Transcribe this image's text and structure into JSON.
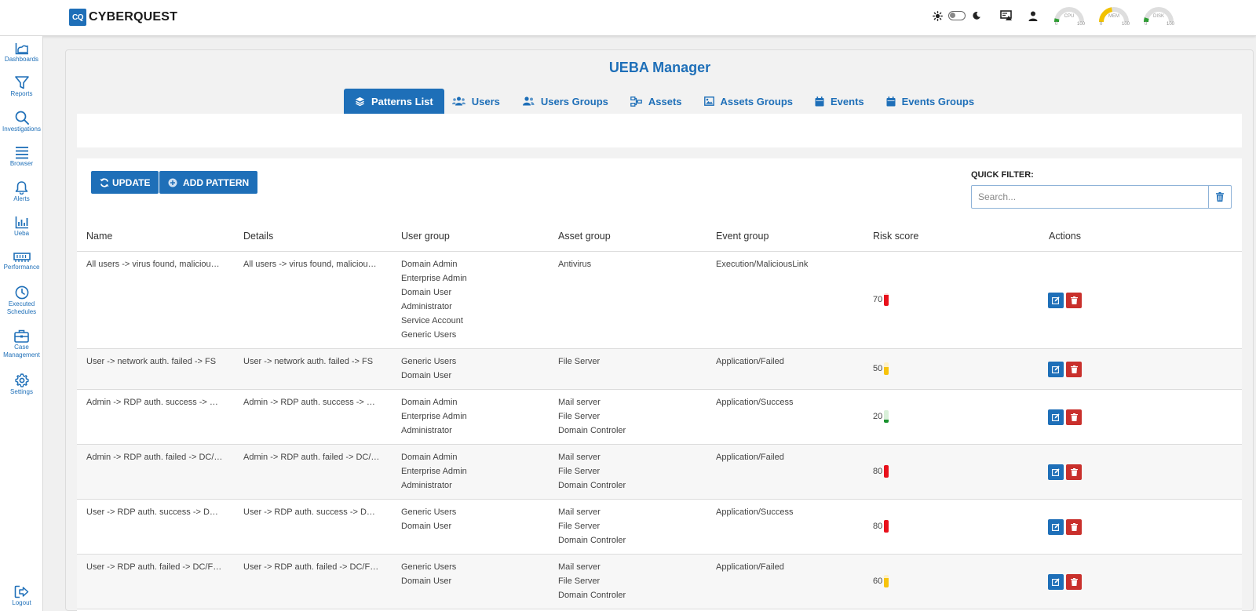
{
  "brand": {
    "mark": "CQ",
    "name": "CYBERQUEST"
  },
  "gauges": [
    {
      "label": "CPU",
      "min": "0",
      "max": "100",
      "value": 8,
      "color": "#2e9e33"
    },
    {
      "label": "MEM",
      "min": "0",
      "max": "100",
      "value": 45,
      "color": "#f2c200"
    },
    {
      "label": "DISK",
      "min": "0",
      "max": "100",
      "value": 10,
      "color": "#2e9e33"
    }
  ],
  "sidebar": {
    "items": [
      {
        "label": "Dashboards",
        "icon": "chart-area-icon"
      },
      {
        "label": "Reports",
        "icon": "filter-icon"
      },
      {
        "label": "Investigations",
        "icon": "search-icon"
      },
      {
        "label": "Browser",
        "icon": "list-icon"
      },
      {
        "label": "Alerts",
        "icon": "bell-icon"
      },
      {
        "label": "Ueba",
        "icon": "bar-chart-icon"
      },
      {
        "label": "Performance",
        "icon": "memory-icon"
      },
      {
        "label1": "Executed",
        "label2": "Schedules",
        "icon": "clock-icon"
      },
      {
        "label1": "Case",
        "label2": "Management",
        "icon": "briefcase-icon"
      },
      {
        "label": "Settings",
        "icon": "gear-icon"
      }
    ],
    "logout": "Logout"
  },
  "page": {
    "title": "UEBA Manager"
  },
  "tabs": [
    {
      "label": "Patterns List",
      "active": true
    },
    {
      "label": "Users"
    },
    {
      "label": "Users Groups"
    },
    {
      "label": "Assets"
    },
    {
      "label": "Assets Groups"
    },
    {
      "label": "Events"
    },
    {
      "label": "Events Groups"
    }
  ],
  "toolbar": {
    "update_label": "UPDATE",
    "add_label": "ADD PATTERN"
  },
  "quick_filter": {
    "label": "QUICK FILTER:",
    "placeholder": "Search..."
  },
  "table": {
    "columns": [
      "Name",
      "Details",
      "User group",
      "Asset group",
      "Event group",
      "Risk score",
      "Actions"
    ],
    "rows": [
      {
        "name": "All users -> virus found, malicious link",
        "details": "All users -> virus found, malicious link",
        "user_groups": [
          "Domain Admin",
          "Enterprise Admin",
          "Domain User",
          "Administrator",
          "Service Account",
          "Generic Users"
        ],
        "asset_groups": [
          "Antivirus"
        ],
        "event_group": "Execution/MaliciousLink",
        "risk": 70
      },
      {
        "name": "User -> network auth. failed -> FS",
        "details": "User -> network auth. failed -> FS",
        "user_groups": [
          "Generic Users",
          "Domain User"
        ],
        "asset_groups": [
          "File Server"
        ],
        "event_group": "Application/Failed",
        "risk": 50
      },
      {
        "name": "Admin -> RDP auth. success -> DC/FS/MS",
        "details": "Admin -> RDP auth. success -> DC/FS/MS",
        "user_groups": [
          "Domain Admin",
          "Enterprise Admin",
          "Administrator"
        ],
        "asset_groups": [
          "Mail server",
          "File Server",
          "Domain Controler"
        ],
        "event_group": "Application/Success",
        "risk": 20
      },
      {
        "name": "Admin -> RDP auth. failed -> DC/FS/MS",
        "details": "Admin -> RDP auth. failed -> DC/FS/MS",
        "user_groups": [
          "Domain Admin",
          "Enterprise Admin",
          "Administrator"
        ],
        "asset_groups": [
          "Mail server",
          "File Server",
          "Domain Controler"
        ],
        "event_group": "Application/Failed",
        "risk": 80
      },
      {
        "name": "User -> RDP auth. success -> DC/FS/MS",
        "details": "User -> RDP auth. success -> DC/FS/MS",
        "user_groups": [
          "Generic Users",
          "Domain User"
        ],
        "asset_groups": [
          "Mail server",
          "File Server",
          "Domain Controler"
        ],
        "event_group": "Application/Success",
        "risk": 80
      },
      {
        "name": "User -> RDP auth. failed -> DC/FS/MS",
        "details": "User -> RDP auth. failed -> DC/FS/MS",
        "user_groups": [
          "Generic Users",
          "Domain User"
        ],
        "asset_groups": [
          "Mail server",
          "File Server",
          "Domain Controler"
        ],
        "event_group": "Application/Failed",
        "risk": 60
      }
    ]
  },
  "colors": {
    "primary": "#1e6fb8",
    "danger": "#c9302c",
    "risk_high": "#e8111c",
    "risk_mid": "#f7c30c",
    "risk_low": "#18912d"
  }
}
